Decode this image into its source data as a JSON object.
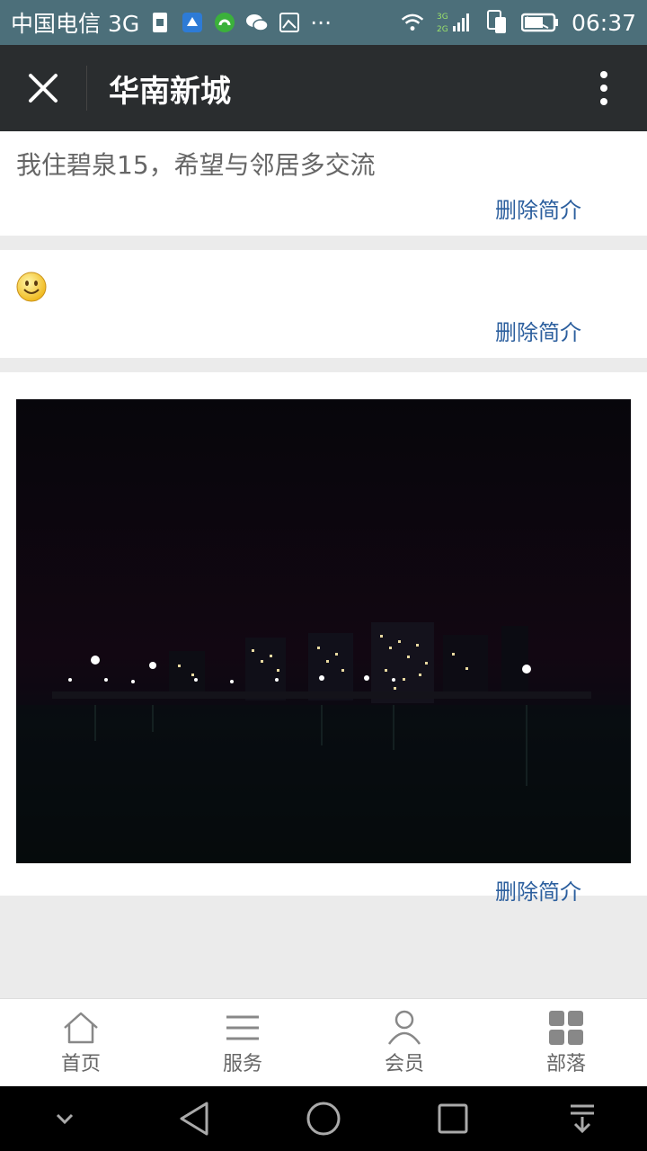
{
  "status_bar": {
    "carrier": "中国电信 3G",
    "network_small": "3G 2G",
    "time": "06:37",
    "dots": "···"
  },
  "title_bar": {
    "title": "华南新城"
  },
  "posts": [
    {
      "text": "我住碧泉15，希望与邻居多交流",
      "delete_label": "删除简介"
    },
    {
      "text": "",
      "delete_label": "删除简介"
    },
    {
      "text": "",
      "delete_label": "删除简介"
    }
  ],
  "tabs": [
    {
      "label": "首页",
      "icon": "home-icon"
    },
    {
      "label": "服务",
      "icon": "list-icon"
    },
    {
      "label": "会员",
      "icon": "user-icon"
    },
    {
      "label": "部落",
      "icon": "grid-icon"
    }
  ],
  "colors": {
    "status_bar": "#4c6f7a",
    "title_bar": "#2a2d2f",
    "link": "#2c5f9e",
    "page_bg": "#ebebeb"
  }
}
